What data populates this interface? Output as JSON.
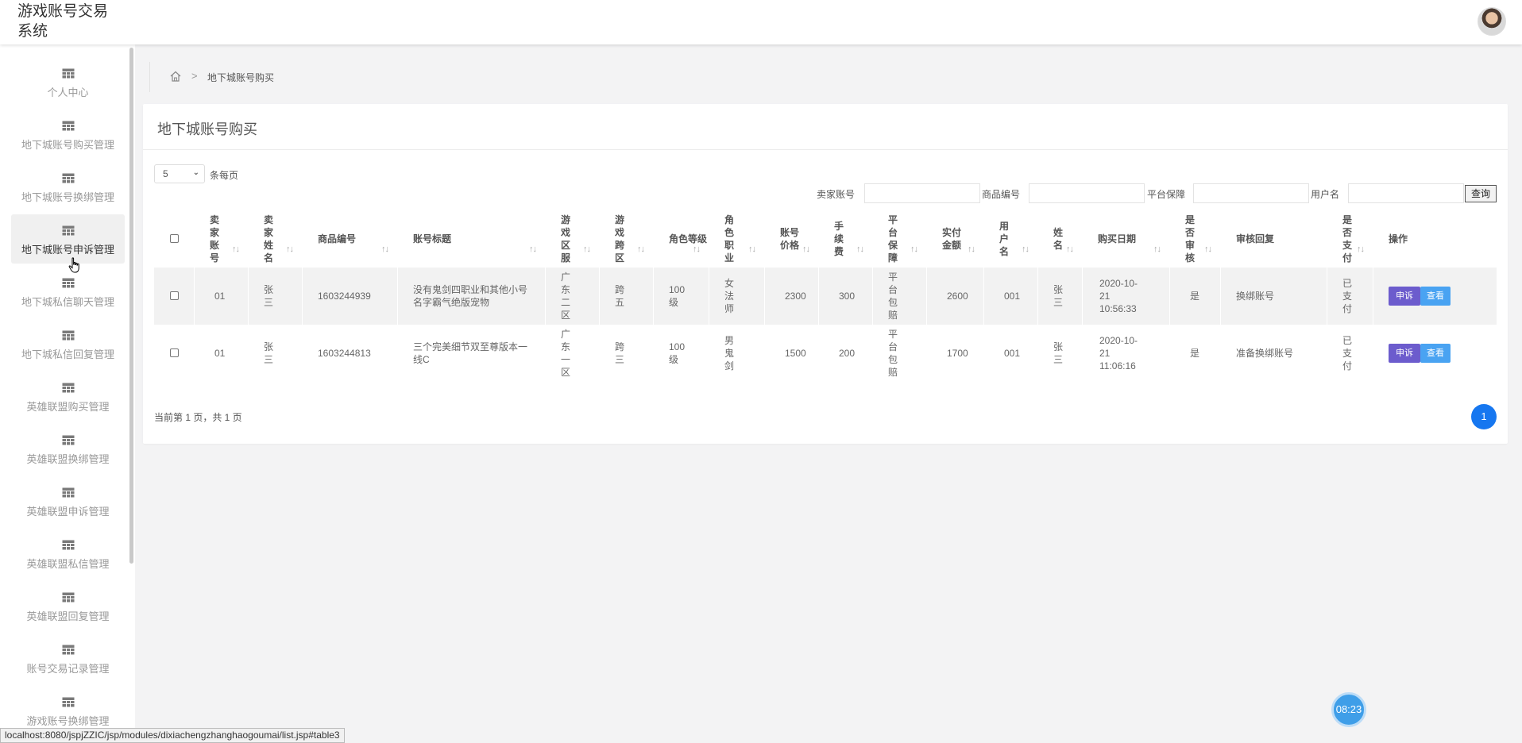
{
  "header": {
    "title": "游戏账号交易系统",
    "avatar_icon": "user-avatar"
  },
  "sidebar": {
    "items": [
      {
        "label": "个人中心"
      },
      {
        "label": "地下城账号购买管理"
      },
      {
        "label": "地下城账号换绑管理"
      },
      {
        "label": "地下城账号申诉管理"
      },
      {
        "label": "地下城私信聊天管理"
      },
      {
        "label": "地下城私信回复管理"
      },
      {
        "label": "英雄联盟购买管理"
      },
      {
        "label": "英雄联盟换绑管理"
      },
      {
        "label": "英雄联盟申诉管理"
      },
      {
        "label": "英雄联盟私信管理"
      },
      {
        "label": "英雄联盟回复管理"
      },
      {
        "label": "账号交易记录管理"
      },
      {
        "label": "游戏账号换绑管理"
      }
    ],
    "active_index": 3
  },
  "breadcrumb": {
    "current": "地下城账号购买",
    "separator": ">"
  },
  "panel": {
    "title": "地下城账号购买"
  },
  "pager": {
    "size": "5",
    "size_label": "条每页",
    "info": "当前第 1 页，共 1 页",
    "current_page": "1"
  },
  "filters": {
    "seller_account_label": "卖家账号",
    "product_no_label": "商品编号",
    "platform_label": "平台保障",
    "username_label": "用户名",
    "search_label": "查询"
  },
  "table": {
    "headers": {
      "seller_account": "卖家账号",
      "seller_name": "卖家姓名",
      "product_no": "商品编号",
      "title": "账号标题",
      "server": "游戏区服",
      "cross": "游戏跨区",
      "level": "角色等级",
      "job": "角色职业",
      "price": "账号价格",
      "fee": "手续费",
      "platform": "平台保障",
      "amount": "实付金额",
      "username": "用户名",
      "name": "姓名",
      "date": "购买日期",
      "audited": "是否审核",
      "reply": "审核回复",
      "paid": "是否支付",
      "ops": "操作"
    },
    "rows": [
      {
        "seller_account": "01",
        "seller_name": "张三",
        "product_no": "1603244939",
        "title": "没有鬼剑四职业和其他小号名字霸气绝版宠物",
        "server": "广东二区",
        "cross": "跨五",
        "level": "100级",
        "job": "女法师",
        "price": "2300",
        "fee": "300",
        "platform": "平台包赔",
        "amount": "2600",
        "username": "001",
        "name": "张三",
        "date_line1": "2020-10-",
        "date_line2": "21",
        "date_line3": "10:56:33",
        "audited": "是",
        "reply": "换绑账号",
        "paid": "已支付"
      },
      {
        "seller_account": "01",
        "seller_name": "张三",
        "product_no": "1603244813",
        "title": "三个完美细节双至尊版本一线C",
        "server": "广东一区",
        "cross": "跨三",
        "level": "100级",
        "job": "男鬼剑",
        "price": "1500",
        "fee": "200",
        "platform": "平台包赔",
        "amount": "1700",
        "username": "001",
        "name": "张三",
        "date_line1": "2020-10-",
        "date_line2": "21",
        "date_line3": "11:06:16",
        "audited": "是",
        "reply": "准备换绑账号",
        "paid": "已支付"
      }
    ],
    "buttons": {
      "complain": "申诉",
      "view": "查看"
    }
  },
  "timer": "08:23",
  "status_url": "localhost:8080/jspjZZIC/jsp/modules/dixiachengzhanghaogoumai/list.jsp#table3",
  "colors": {
    "primary": "#1677f0",
    "complain_btn": "#6c5ccd",
    "view_btn": "#49a3f2"
  }
}
